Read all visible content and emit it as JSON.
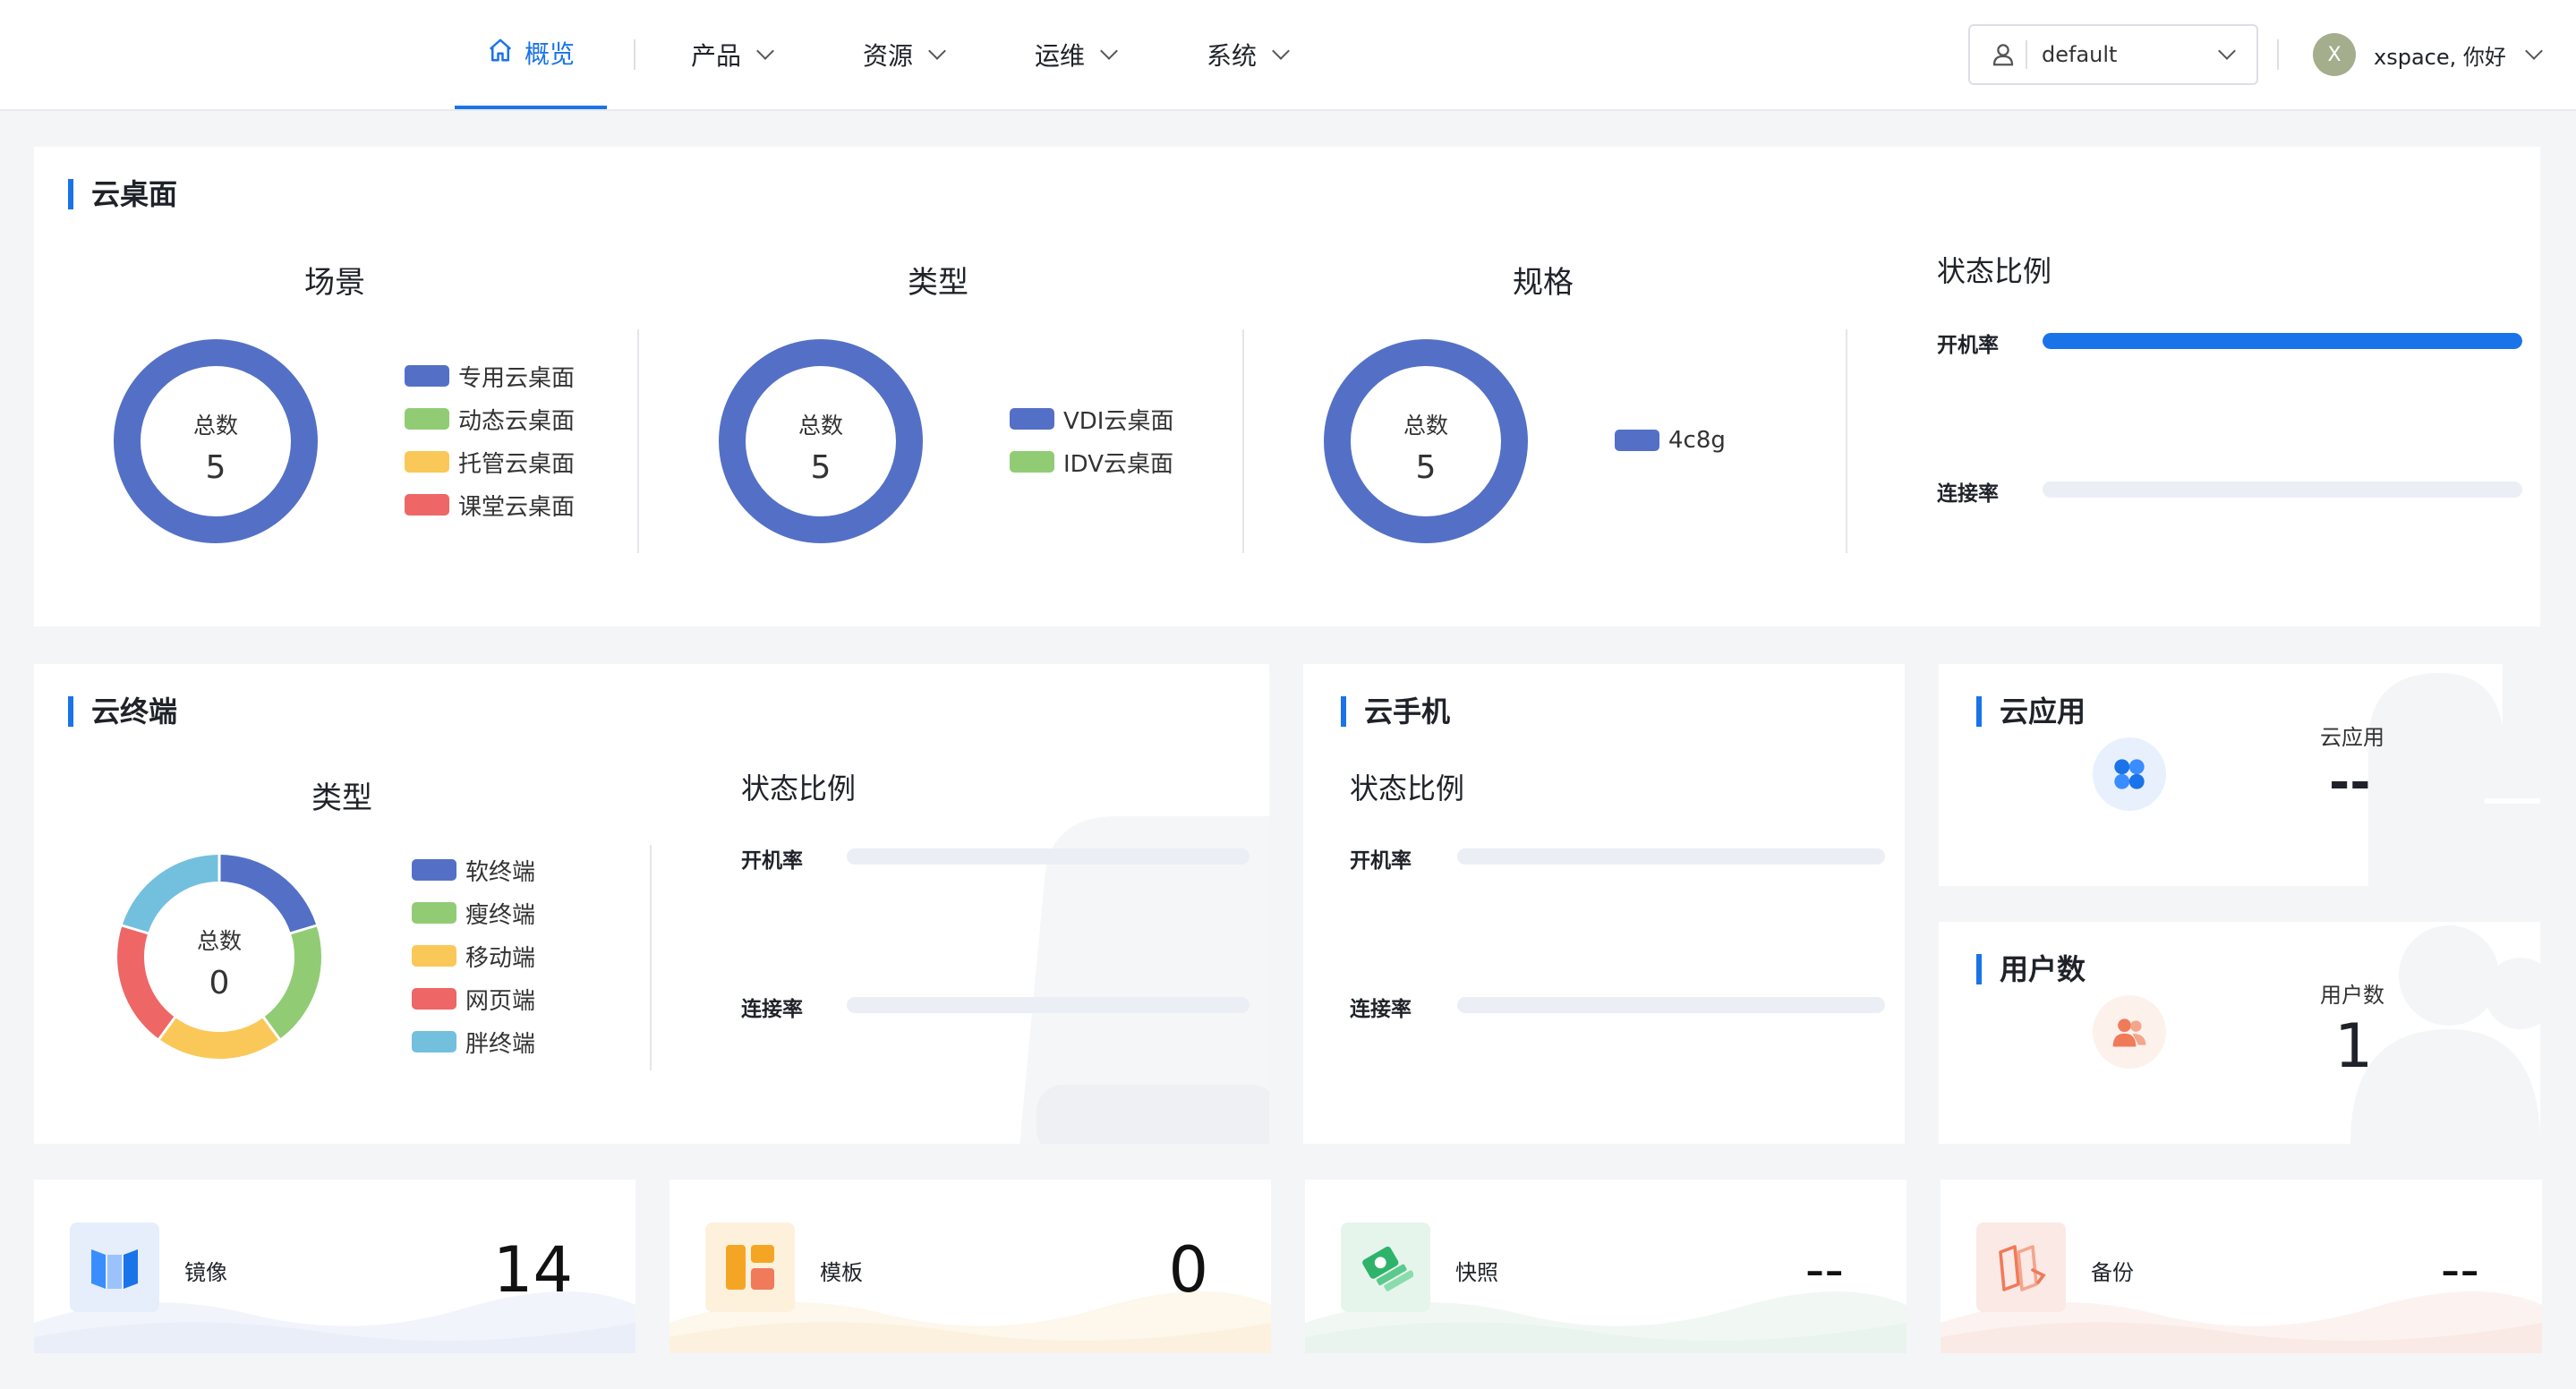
{
  "nav": {
    "items": [
      {
        "label": "概览",
        "active": true
      },
      {
        "label": "产品"
      },
      {
        "label": "资源"
      },
      {
        "label": "运维"
      },
      {
        "label": "系统"
      }
    ],
    "namespace": "default",
    "user_greeting": "xspace, 你好",
    "avatar_letter": "X"
  },
  "desktop": {
    "title": "云桌面",
    "scene": {
      "title": "场景",
      "total_label": "总数",
      "total": "5",
      "legend": [
        {
          "label": "专用云桌面",
          "color": "#5470c6"
        },
        {
          "label": "动态云桌面",
          "color": "#91cc75"
        },
        {
          "label": "托管云桌面",
          "color": "#fac858"
        },
        {
          "label": "课堂云桌面",
          "color": "#ee6666"
        }
      ]
    },
    "type": {
      "title": "类型",
      "total_label": "总数",
      "total": "5",
      "legend": [
        {
          "label": "VDI云桌面",
          "color": "#5470c6"
        },
        {
          "label": "IDV云桌面",
          "color": "#91cc75"
        }
      ]
    },
    "spec": {
      "title": "规格",
      "total_label": "总数",
      "total": "5",
      "legend": [
        {
          "label": "4c8g",
          "color": "#5470c6"
        }
      ]
    },
    "status": {
      "title": "状态比例",
      "power_on_label": "开机率",
      "power_on_ratio": 1.0,
      "connect_label": "连接率",
      "connect_ratio": 0
    }
  },
  "terminal": {
    "title": "云终端",
    "type_title": "类型",
    "total_label": "总数",
    "total": "0",
    "legend": [
      {
        "label": "软终端",
        "color": "#5470c6"
      },
      {
        "label": "瘦终端",
        "color": "#91cc75"
      },
      {
        "label": "移动端",
        "color": "#fac858"
      },
      {
        "label": "网页端",
        "color": "#ee6666"
      },
      {
        "label": "胖终端",
        "color": "#73c0de"
      }
    ],
    "status_title": "状态比例",
    "power_on_label": "开机率",
    "power_on_ratio": 0,
    "connect_label": "连接率",
    "connect_ratio": 0
  },
  "phone": {
    "title": "云手机",
    "status_title": "状态比例",
    "power_on_label": "开机率",
    "power_on_ratio": 0,
    "connect_label": "连接率",
    "connect_ratio": 0
  },
  "apps": {
    "title": "云应用",
    "stat_label": "云应用",
    "stat_value": "--"
  },
  "users": {
    "title": "用户数",
    "stat_label": "用户数",
    "stat_value": "1"
  },
  "resources": [
    {
      "label": "镜像",
      "value": "14",
      "icon": "image-icon"
    },
    {
      "label": "模板",
      "value": "0",
      "icon": "template-icon"
    },
    {
      "label": "快照",
      "value": "--",
      "icon": "snapshot-icon"
    },
    {
      "label": "备份",
      "value": "--",
      "icon": "backup-icon"
    }
  ]
}
